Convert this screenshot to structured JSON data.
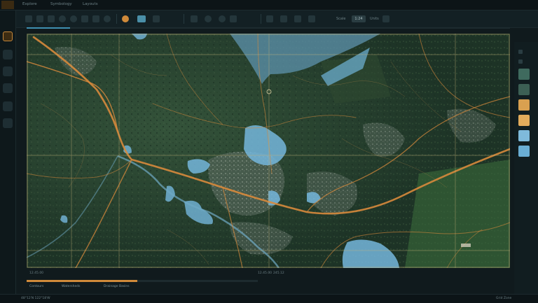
{
  "menu": {
    "items": [
      "Explore",
      "Symbology",
      "Layouts"
    ]
  },
  "toolbar": {
    "scale_label": "Scale",
    "scale_value": "1:24",
    "units_label": "Units"
  },
  "legend": {
    "items": [
      {
        "color": "#3f6a5e"
      },
      {
        "color": "#3c5f54"
      },
      {
        "color": "#d9a050"
      },
      {
        "color": "#e3ac5c"
      },
      {
        "color": "#7fbadb"
      },
      {
        "color": "#6aaed4"
      }
    ]
  },
  "status": {
    "segments": [
      "12.45.00",
      "12.45.00",
      "245.12"
    ],
    "progress_top": 0.09,
    "progress_bottom": 0.48
  },
  "layers": {
    "items": [
      "Contours",
      "Watersheds",
      "Drainage Basins"
    ]
  },
  "footer": {
    "left": "48°12′N 122°18′W",
    "right": "Grid Zone"
  },
  "colors": {
    "accent_orange": "#d08a3a",
    "water_blue": "#6fb4d8",
    "road_orange": "#d88a3c",
    "grid_line": "#c9b47a"
  }
}
